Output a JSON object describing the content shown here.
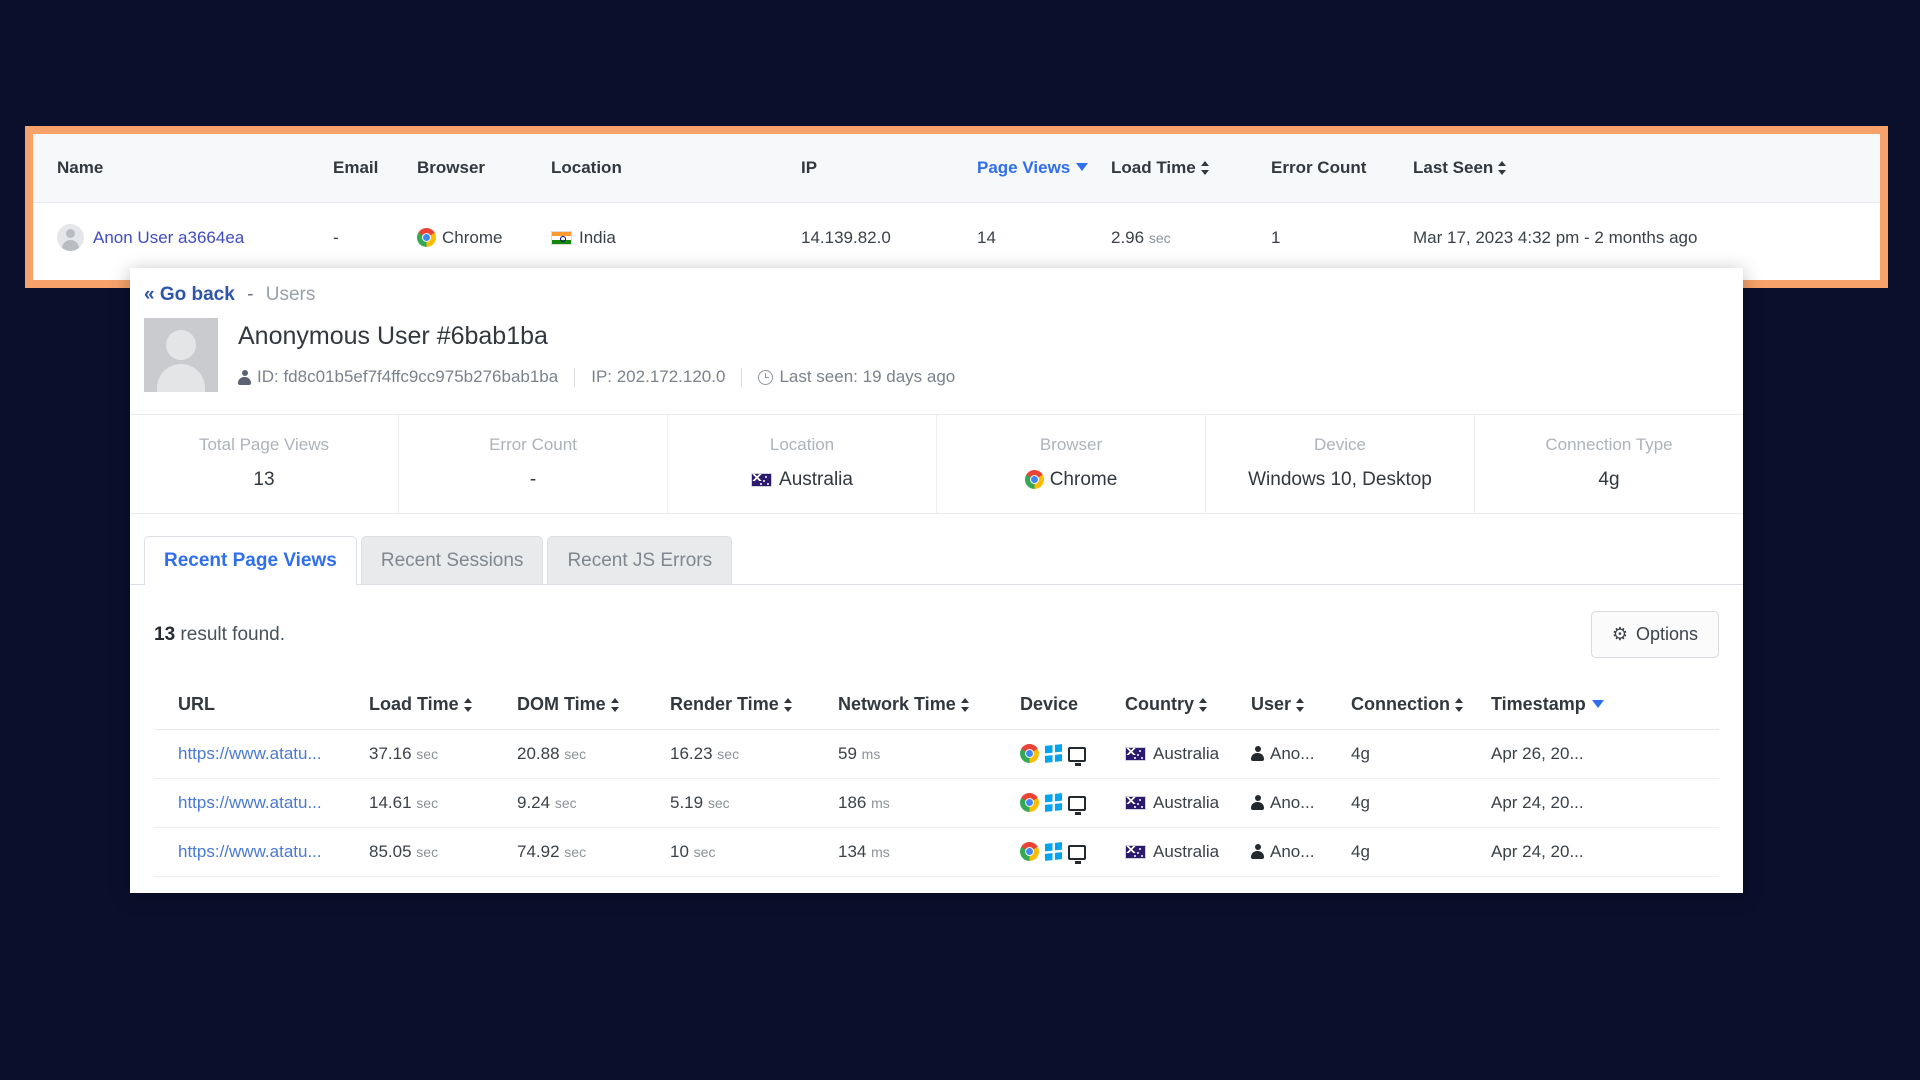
{
  "colors": {
    "page_background": "#0a0f2c",
    "highlight_border": "#f6a26a",
    "link_blue": "#2f6fed",
    "panel_background": "#ffffff"
  },
  "users_table": {
    "name": "users-table",
    "columns": [
      {
        "label": "Name",
        "sortable": false,
        "sorted": false
      },
      {
        "label": "Email",
        "sortable": false,
        "sorted": false
      },
      {
        "label": "Browser",
        "sortable": false,
        "sorted": false
      },
      {
        "label": "Location",
        "sortable": false,
        "sorted": false
      },
      {
        "label": "IP",
        "sortable": false,
        "sorted": false
      },
      {
        "label": "Page Views",
        "sortable": true,
        "sorted": true,
        "direction": "desc"
      },
      {
        "label": "Load Time",
        "sortable": true,
        "sorted": false
      },
      {
        "label": "Error Count",
        "sortable": false,
        "sorted": false
      },
      {
        "label": "Last Seen",
        "sortable": true,
        "sorted": false
      }
    ],
    "rows": [
      {
        "name": "Anon User a3664ea",
        "email": "-",
        "browser": "Chrome",
        "browser_icon": "chrome-icon",
        "location": "India",
        "location_flag": "flag-india-icon",
        "ip": "14.139.82.0",
        "page_views": "14",
        "load_time_value": "2.96",
        "load_time_unit": "sec",
        "error_count": "1",
        "last_seen": "Mar 17, 2023 4:32 pm - 2 months ago"
      }
    ]
  },
  "detail_panel": {
    "breadcrumb": {
      "back_label": "« Go back",
      "separator": "-",
      "current": "Users"
    },
    "title": "Anonymous User #6bab1ba",
    "meta": {
      "id_label": "ID: fd8c01b5ef7f4ffc9cc975b276bab1ba",
      "ip_label": "IP: 202.172.120.0",
      "last_seen_label": "Last seen: 19 days ago"
    },
    "stats": [
      {
        "label": "Total Page Views",
        "value": "13",
        "icon": ""
      },
      {
        "label": "Error Count",
        "value": "-",
        "icon": ""
      },
      {
        "label": "Location",
        "value": "Australia",
        "icon": "flag-australia-icon"
      },
      {
        "label": "Browser",
        "value": "Chrome",
        "icon": "chrome-icon"
      },
      {
        "label": "Device",
        "value": "Windows 10, Desktop",
        "icon": ""
      },
      {
        "label": "Connection Type",
        "value": "4g",
        "icon": ""
      }
    ],
    "tabs": [
      {
        "label": "Recent Page Views",
        "active": true
      },
      {
        "label": "Recent Sessions",
        "active": false
      },
      {
        "label": "Recent JS Errors",
        "active": false
      }
    ],
    "result_count": "13",
    "result_suffix": " result found.",
    "options_button": "Options",
    "page_views_table": {
      "columns": [
        {
          "label": "URL",
          "sortable": false,
          "sorted": false
        },
        {
          "label": "Load Time",
          "sortable": true,
          "sorted": false
        },
        {
          "label": "DOM Time",
          "sortable": true,
          "sorted": false
        },
        {
          "label": "Render Time",
          "sortable": true,
          "sorted": false
        },
        {
          "label": "Network Time",
          "sortable": true,
          "sorted": false
        },
        {
          "label": "Device",
          "sortable": false,
          "sorted": false
        },
        {
          "label": "Country",
          "sortable": true,
          "sorted": false
        },
        {
          "label": "User",
          "sortable": true,
          "sorted": false
        },
        {
          "label": "Connection",
          "sortable": true,
          "sorted": false
        },
        {
          "label": "Timestamp",
          "sortable": true,
          "sorted": true,
          "direction": "desc"
        }
      ],
      "rows": [
        {
          "url": "https://www.atatu...",
          "load_time": "37.16",
          "load_time_unit": "sec",
          "dom_time": "20.88",
          "dom_time_unit": "sec",
          "render_time": "16.23",
          "render_time_unit": "sec",
          "network_time": "59",
          "network_time_unit": "ms",
          "device_icons": "chrome-icon windows-icon desktop-icon",
          "country": "Australia",
          "user": "Ano...",
          "connection": "4g",
          "timestamp": "Apr 26, 20..."
        },
        {
          "url": "https://www.atatu...",
          "load_time": "14.61",
          "load_time_unit": "sec",
          "dom_time": "9.24",
          "dom_time_unit": "sec",
          "render_time": "5.19",
          "render_time_unit": "sec",
          "network_time": "186",
          "network_time_unit": "ms",
          "device_icons": "chrome-icon windows-icon desktop-icon",
          "country": "Australia",
          "user": "Ano...",
          "connection": "4g",
          "timestamp": "Apr 24, 20..."
        },
        {
          "url": "https://www.atatu...",
          "load_time": "85.05",
          "load_time_unit": "sec",
          "dom_time": "74.92",
          "dom_time_unit": "sec",
          "render_time": "10",
          "render_time_unit": "sec",
          "network_time": "134",
          "network_time_unit": "ms",
          "device_icons": "chrome-icon windows-icon desktop-icon",
          "country": "Australia",
          "user": "Ano...",
          "connection": "4g",
          "timestamp": "Apr 24, 20..."
        }
      ]
    }
  }
}
